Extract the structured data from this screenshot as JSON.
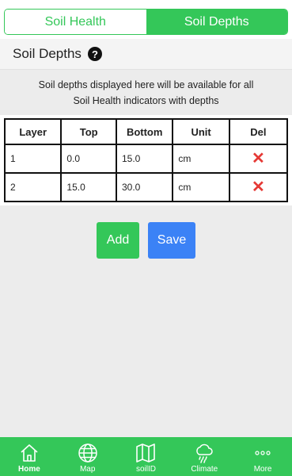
{
  "segments": {
    "left": "Soil Health",
    "right": "Soil Depths"
  },
  "section": {
    "title": "Soil Depths",
    "help_glyph": "?"
  },
  "description": {
    "line1": "Soil depths displayed here will be available for all",
    "line2": "Soil Health indicators with depths"
  },
  "table": {
    "headers": [
      "Layer",
      "Top",
      "Bottom",
      "Unit",
      "Del"
    ],
    "rows": [
      {
        "layer": "1",
        "top": "0.0",
        "bottom": "15.0",
        "unit": "cm",
        "del": "✕"
      },
      {
        "layer": "2",
        "top": "15.0",
        "bottom": "30.0",
        "unit": "cm",
        "del": "✕"
      }
    ]
  },
  "actions": {
    "add": "Add",
    "save": "Save"
  },
  "tabs": [
    {
      "label": "Home",
      "icon": "home-icon"
    },
    {
      "label": "Map",
      "icon": "globe-icon"
    },
    {
      "label": "soilID",
      "icon": "map-icon"
    },
    {
      "label": "Climate",
      "icon": "cloud-rain-icon"
    },
    {
      "label": "More",
      "icon": "dots-icon"
    }
  ],
  "colors": {
    "green": "#34c759",
    "blue": "#3b82f6",
    "delete_red": "#e53935"
  }
}
